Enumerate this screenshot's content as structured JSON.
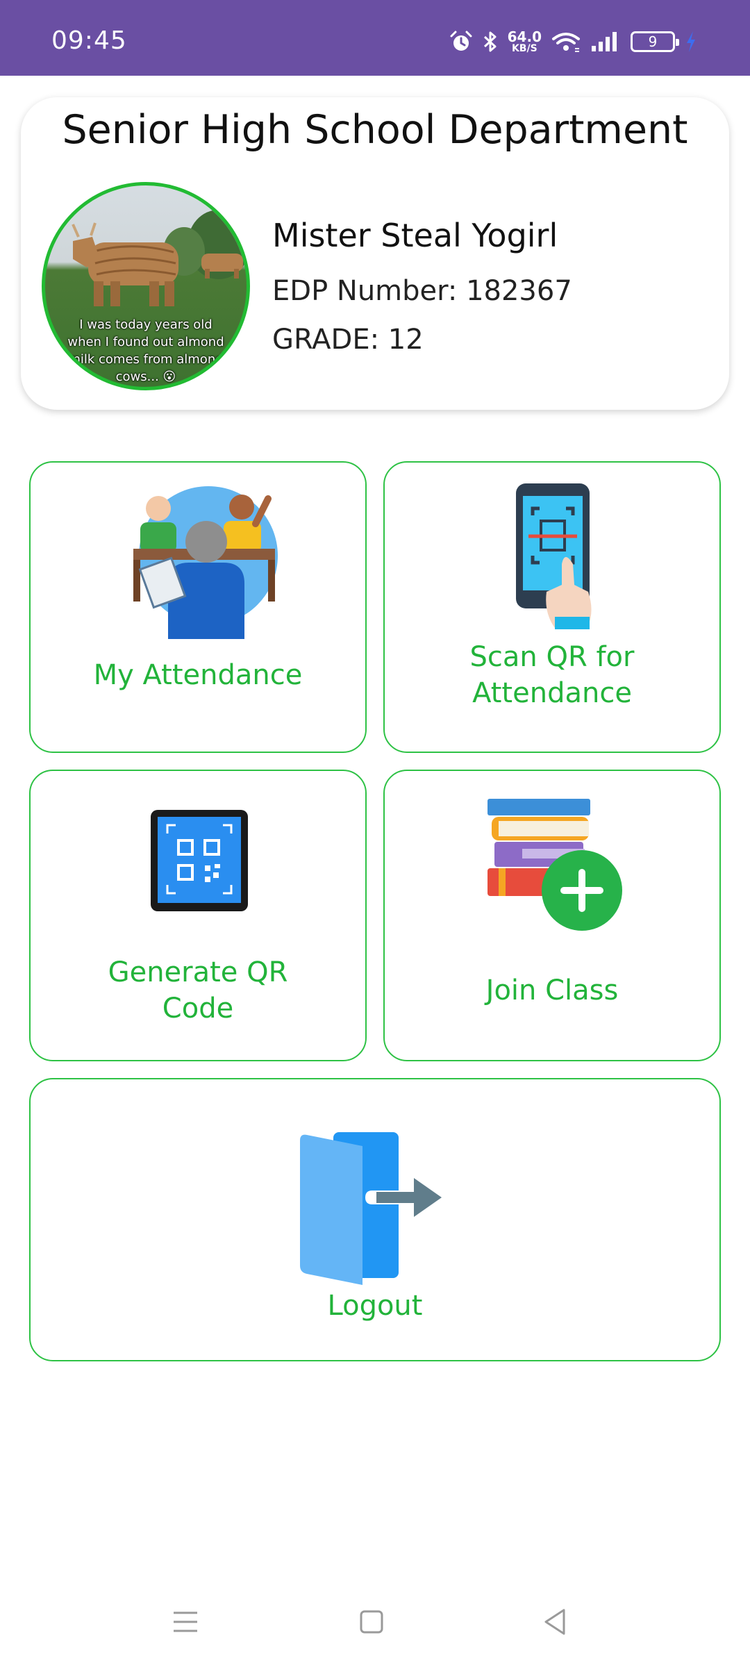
{
  "status_bar": {
    "time": "09:45",
    "net_speed_value": "64.0",
    "net_speed_unit": "KB/S",
    "battery_level": "9",
    "background_color": "#6a4fa3"
  },
  "profile": {
    "department": "Senior High School Department",
    "name": "Mister Steal Yogirl",
    "edp_line": "EDP Number: 182367",
    "grade_line": "GRADE: 12",
    "avatar_caption": [
      "I was today years old",
      "when I found out almond",
      "milk comes from almond",
      "cows... 😮"
    ]
  },
  "tiles": {
    "my_attendance": "My Attendance",
    "scan_qr": [
      "Scan QR for",
      "Attendance"
    ],
    "generate_qr": [
      "Generate QR",
      "Code"
    ],
    "join_class": "Join Class",
    "logout": "Logout"
  },
  "colors": {
    "accent_green": "#22b33a",
    "tile_border": "#2ec245"
  },
  "nav": {
    "icons": [
      "menu-icon",
      "home-square-icon",
      "back-triangle-icon"
    ]
  }
}
